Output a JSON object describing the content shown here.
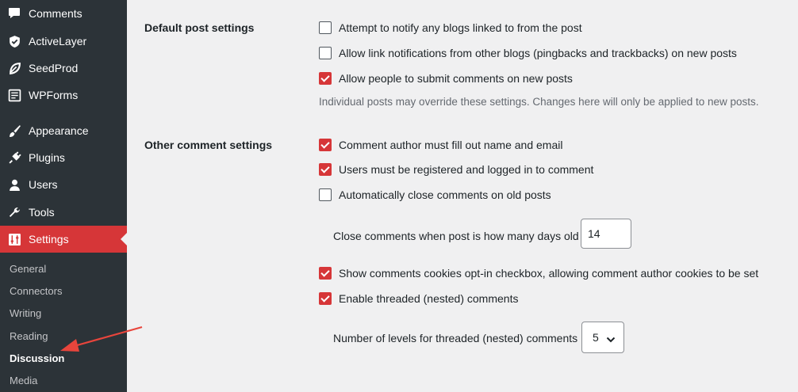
{
  "sidebar": {
    "items": [
      {
        "label": "Comments",
        "icon": "speech-bubble-icon"
      },
      {
        "label": "ActiveLayer",
        "icon": "shield-icon"
      },
      {
        "label": "SeedProd",
        "icon": "leaf-icon"
      },
      {
        "label": "WPForms",
        "icon": "form-icon"
      },
      {
        "label": "Appearance",
        "icon": "paintbrush-icon"
      },
      {
        "label": "Plugins",
        "icon": "plug-icon"
      },
      {
        "label": "Users",
        "icon": "user-icon"
      },
      {
        "label": "Tools",
        "icon": "wrench-icon"
      },
      {
        "label": "Settings",
        "icon": "sliders-icon",
        "active": true
      }
    ],
    "submenu": [
      "General",
      "Connectors",
      "Writing",
      "Reading",
      "Discussion",
      "Media"
    ],
    "current_submenu": "Discussion"
  },
  "default_post": {
    "label": "Default post settings",
    "options": [
      {
        "text": "Attempt to notify any blogs linked to from the post",
        "checked": false
      },
      {
        "text": "Allow link notifications from other blogs (pingbacks and trackbacks) on new posts",
        "checked": false
      },
      {
        "text": "Allow people to submit comments on new posts",
        "checked": true
      }
    ],
    "note": "Individual posts may override these settings. Changes here will only be applied to new posts."
  },
  "other_comment": {
    "label": "Other comment settings",
    "options": [
      {
        "text": "Comment author must fill out name and email",
        "checked": true
      },
      {
        "text": "Users must be registered and logged in to comment",
        "checked": true
      },
      {
        "text": "Automatically close comments on old posts",
        "checked": false
      }
    ],
    "close_days_label": "Close comments when post is how many days old",
    "close_days_value": "14",
    "options2": [
      {
        "text": "Show comments cookies opt-in checkbox, allowing comment author cookies to be set",
        "checked": true
      },
      {
        "text": "Enable threaded (nested) comments",
        "checked": true
      }
    ],
    "thread_levels_label": "Number of levels for threaded (nested) comments",
    "thread_levels_value": "5"
  },
  "colors": {
    "accent": "#d63638",
    "sidebar_bg": "#2c3338",
    "page_bg": "#f0f0f1",
    "arrow": "#e8453c"
  }
}
